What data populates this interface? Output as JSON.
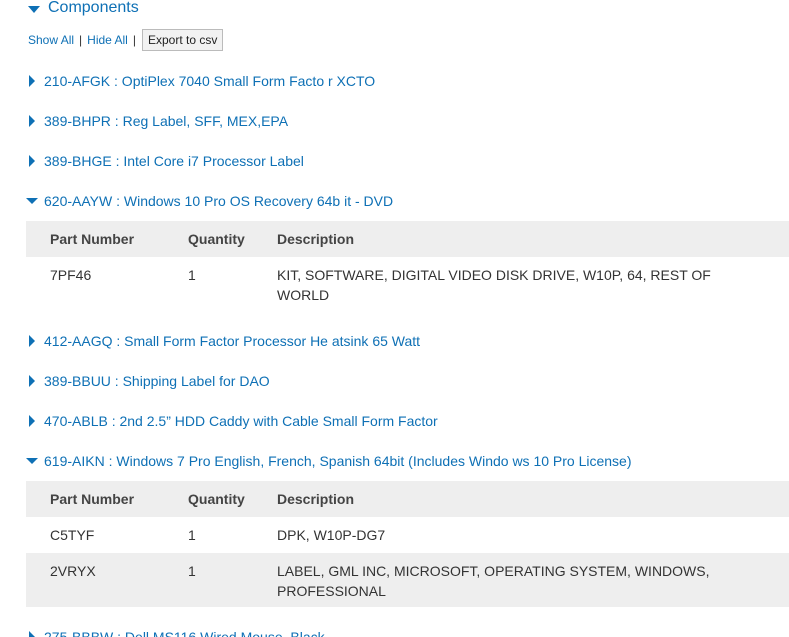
{
  "section": {
    "title": "Components"
  },
  "toolbar": {
    "show_all": "Show All",
    "separator": "|",
    "hide_all": "Hide All",
    "export": "Export to csv"
  },
  "table_headers": {
    "part_number": "Part Number",
    "quantity": "Quantity",
    "description": "Description"
  },
  "items": [
    {
      "label": "210-AFGK : OptiPlex 7040 Small Form Facto r XCTO",
      "expanded": false
    },
    {
      "label": "389-BHPR : Reg Label, SFF, MEX,EPA",
      "expanded": false
    },
    {
      "label": "389-BHGE : Intel Core i7 Processor Label",
      "expanded": false
    },
    {
      "label": "620-AAYW : Windows 10 Pro OS Recovery 64b it - DVD",
      "expanded": true,
      "parts": [
        {
          "part_number": "7PF46",
          "quantity": "1",
          "description": "KIT, SOFTWARE, DIGITAL VIDEO DISK DRIVE, W10P, 64, REST OF WORLD"
        }
      ]
    },
    {
      "label": "412-AAGQ : Small Form Factor Processor He atsink 65 Watt",
      "expanded": false
    },
    {
      "label": "389-BBUU : Shipping Label for DAO",
      "expanded": false
    },
    {
      "label": "470-ABLB : 2nd 2.5” HDD Caddy with Cable Small Form Factor",
      "expanded": false
    },
    {
      "label": "619-AIKN : Windows 7 Pro English, French, Spanish 64bit (Includes Windo ws 10 Pro License)",
      "expanded": true,
      "parts": [
        {
          "part_number": "C5TYF",
          "quantity": "1",
          "description": "DPK, W10P-DG7"
        },
        {
          "part_number": "2VRYX",
          "quantity": "1",
          "description": "LABEL, GML INC, MICROSOFT, OPERATING SYSTEM, WINDOWS, PROFESSIONAL"
        }
      ]
    },
    {
      "label": "275-BBBW : Dell MS116 Wired Mouse, Black",
      "expanded": false
    }
  ],
  "colors": {
    "link": "#0e70b5",
    "table_header_bg": "#eeeeee",
    "text": "#333333"
  }
}
